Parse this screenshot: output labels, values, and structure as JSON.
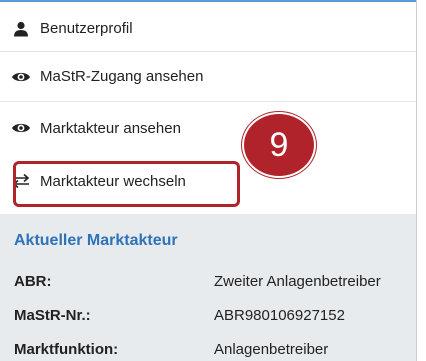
{
  "menu": {
    "items": [
      {
        "label": "Benutzerprofil",
        "icon": "user-icon"
      },
      {
        "label": "MaStR-Zugang ansehen",
        "icon": "eye-icon"
      },
      {
        "label": "Marktakteur ansehen",
        "icon": "eye-icon"
      },
      {
        "label": "Marktakteur wechseln",
        "icon": "swap-arrows-icon"
      }
    ]
  },
  "annotation": {
    "step": "9",
    "color": "#b0232a"
  },
  "current_actor": {
    "title": "Aktueller Marktakteur",
    "rows": [
      {
        "key": "ABR:",
        "value": "Zweiter Anlagenbetreiber"
      },
      {
        "key": "MaStR-Nr.:",
        "value": "ABR980106927152"
      },
      {
        "key": "Marktfunktion:",
        "value": "Anlagenbetreiber"
      }
    ]
  },
  "colors": {
    "accent": "#2e72b8",
    "panel_bg": "#e8ebee"
  }
}
